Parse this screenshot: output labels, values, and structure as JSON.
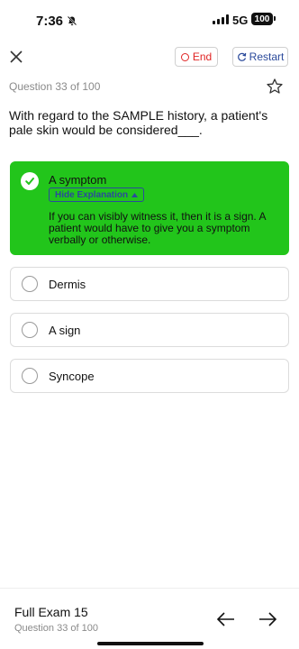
{
  "status_bar": {
    "time": "7:36",
    "network": "5G",
    "battery": "100"
  },
  "toolbar": {
    "end_label": "End",
    "restart_label": "Restart"
  },
  "question": {
    "counter": "Question 33 of 100",
    "text": "With regard to the SAMPLE history, a patient's pale skin would be considered___."
  },
  "options": [
    {
      "label": "A symptom",
      "correct": true,
      "hide_explanation_label": "Hide Explanation",
      "explanation": "If you can visibly witness it, then it is a sign. A patient would have to give you a symptom verbally or otherwise."
    },
    {
      "label": "Dermis"
    },
    {
      "label": "A sign"
    },
    {
      "label": "Syncope"
    }
  ],
  "footer": {
    "exam_title": "Full Exam 15",
    "counter": "Question 33 of 100"
  },
  "colors": {
    "correct_bg": "#22c51b",
    "end_red": "#e02424",
    "link_blue": "#2b4a9b"
  }
}
